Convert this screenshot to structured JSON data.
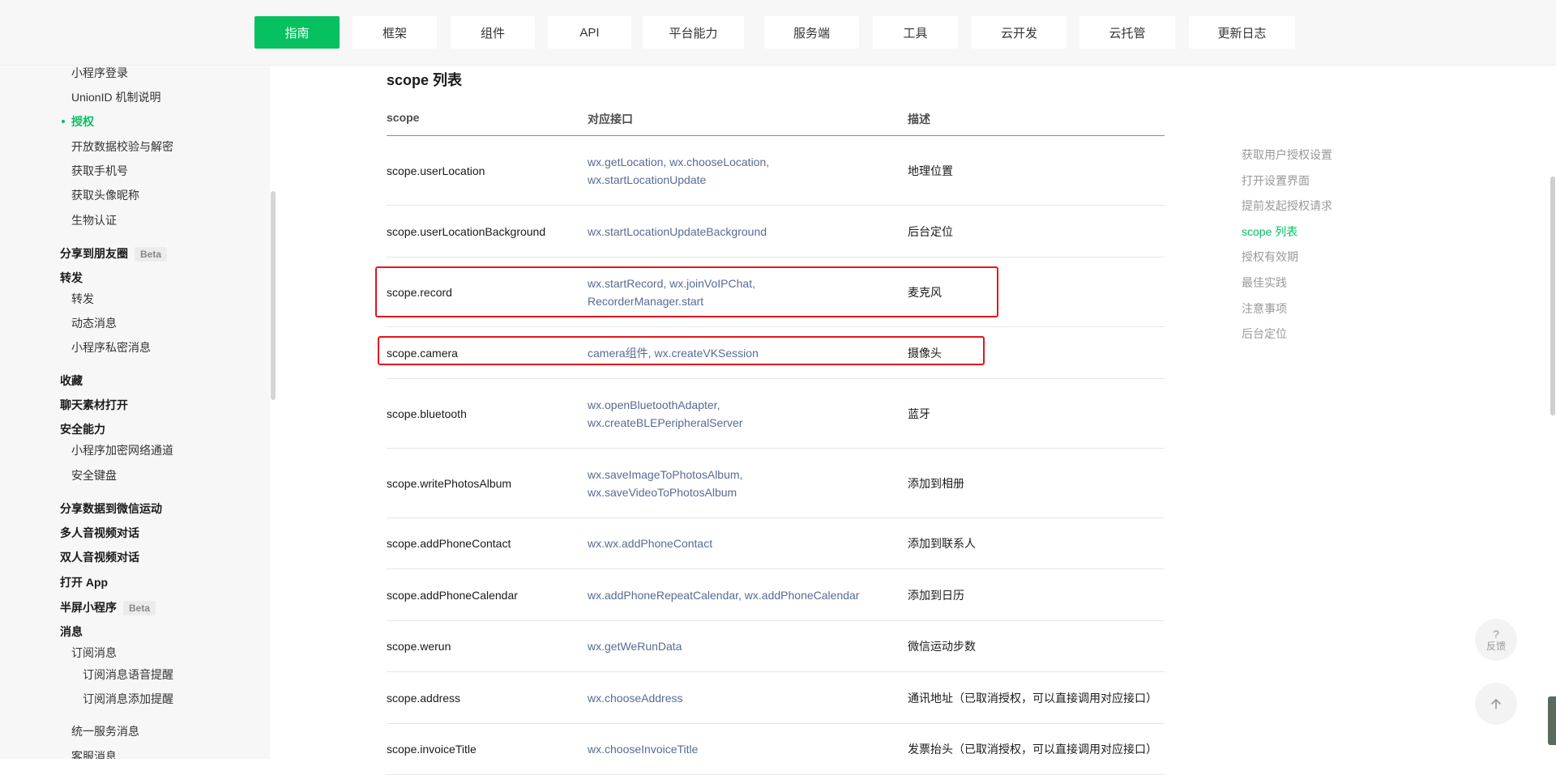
{
  "nav": {
    "tabs": [
      "指南",
      "框架",
      "组件",
      "API",
      "平台能力",
      "服务端",
      "工具",
      "云开发",
      "云托管",
      "更新日志"
    ],
    "active_index": 0,
    "accent_color": "#07c160"
  },
  "sidebar": {
    "items": [
      {
        "label": "小程序登录"
      },
      {
        "label": "UnionID 机制说明"
      },
      {
        "label": "授权"
      },
      {
        "label": "开放数据校验与解密"
      },
      {
        "label": "获取手机号"
      },
      {
        "label": "获取头像昵称"
      },
      {
        "label": "生物认证"
      },
      {
        "label": "分享到朋友圈",
        "badge": "Beta"
      },
      {
        "label": "转发"
      },
      {
        "label": "转发"
      },
      {
        "label": "动态消息"
      },
      {
        "label": "小程序私密消息"
      },
      {
        "label": "收藏"
      },
      {
        "label": "聊天素材打开"
      },
      {
        "label": "安全能力"
      },
      {
        "label": "小程序加密网络通道"
      },
      {
        "label": "安全键盘"
      },
      {
        "label": "分享数据到微信运动"
      },
      {
        "label": "多人音视频对话"
      },
      {
        "label": "双人音视频对话"
      },
      {
        "label": "打开 App"
      },
      {
        "label": "半屏小程序",
        "badge": "Beta"
      },
      {
        "label": "消息"
      },
      {
        "label": "订阅消息"
      },
      {
        "label": "订阅消息语音提醒"
      },
      {
        "label": "订阅消息添加提醒"
      },
      {
        "label": "统一服务消息"
      },
      {
        "label": "客服消息"
      }
    ]
  },
  "main": {
    "section_title": "scope 列表",
    "columns": [
      "scope",
      "对应接口",
      "描述"
    ],
    "rows": [
      {
        "scope": "scope.userLocation",
        "apis": [
          "wx.getLocation, wx.chooseLocation,",
          "wx.startLocationUpdate"
        ],
        "desc": "地理位置"
      },
      {
        "scope": "scope.userLocationBackground",
        "apis": [
          "wx.startLocationUpdateBackground"
        ],
        "desc": "后台定位"
      },
      {
        "scope": "scope.record",
        "apis": [
          "wx.startRecord, wx.joinVoIPChat,",
          "RecorderManager.start"
        ],
        "desc": "麦克风"
      },
      {
        "scope": "scope.camera",
        "apis": [
          "camera组件, wx.createVKSession"
        ],
        "desc": "摄像头"
      },
      {
        "scope": "scope.bluetooth",
        "apis": [
          "wx.openBluetoothAdapter,",
          "wx.createBLEPeripheralServer"
        ],
        "desc": "蓝牙"
      },
      {
        "scope": "scope.writePhotosAlbum",
        "apis": [
          "wx.saveImageToPhotosAlbum,",
          "wx.saveVideoToPhotosAlbum"
        ],
        "desc": "添加到相册"
      },
      {
        "scope": "scope.addPhoneContact",
        "apis": [
          "wx.wx.addPhoneContact"
        ],
        "desc": "添加到联系人"
      },
      {
        "scope": "scope.addPhoneCalendar",
        "apis": [
          "wx.addPhoneRepeatCalendar, wx.addPhoneCalendar"
        ],
        "desc": "添加到日历"
      },
      {
        "scope": "scope.werun",
        "apis": [
          "wx.getWeRunData"
        ],
        "desc": "微信运动步数"
      },
      {
        "scope": "scope.address",
        "apis": [
          "wx.chooseAddress"
        ],
        "desc": "通讯地址（已取消授权，可以直接调用对应接口）"
      },
      {
        "scope": "scope.invoiceTitle",
        "apis": [
          "wx.chooseInvoiceTitle"
        ],
        "desc": "发票抬头（已取消授权，可以直接调用对应接口）"
      }
    ],
    "link_color": "#576b95",
    "highlight_color": "#e4161b"
  },
  "toc": {
    "items": [
      "获取用户授权设置",
      "打开设置界面",
      "提前发起授权请求",
      "scope 列表",
      "授权有效期",
      "最佳实践",
      "注意事项",
      "后台定位"
    ],
    "active_index": 3
  },
  "floating": {
    "feedback_glyph": "?",
    "feedback_label": "反馈",
    "back_to_top_icon": "arrow-up-icon"
  }
}
